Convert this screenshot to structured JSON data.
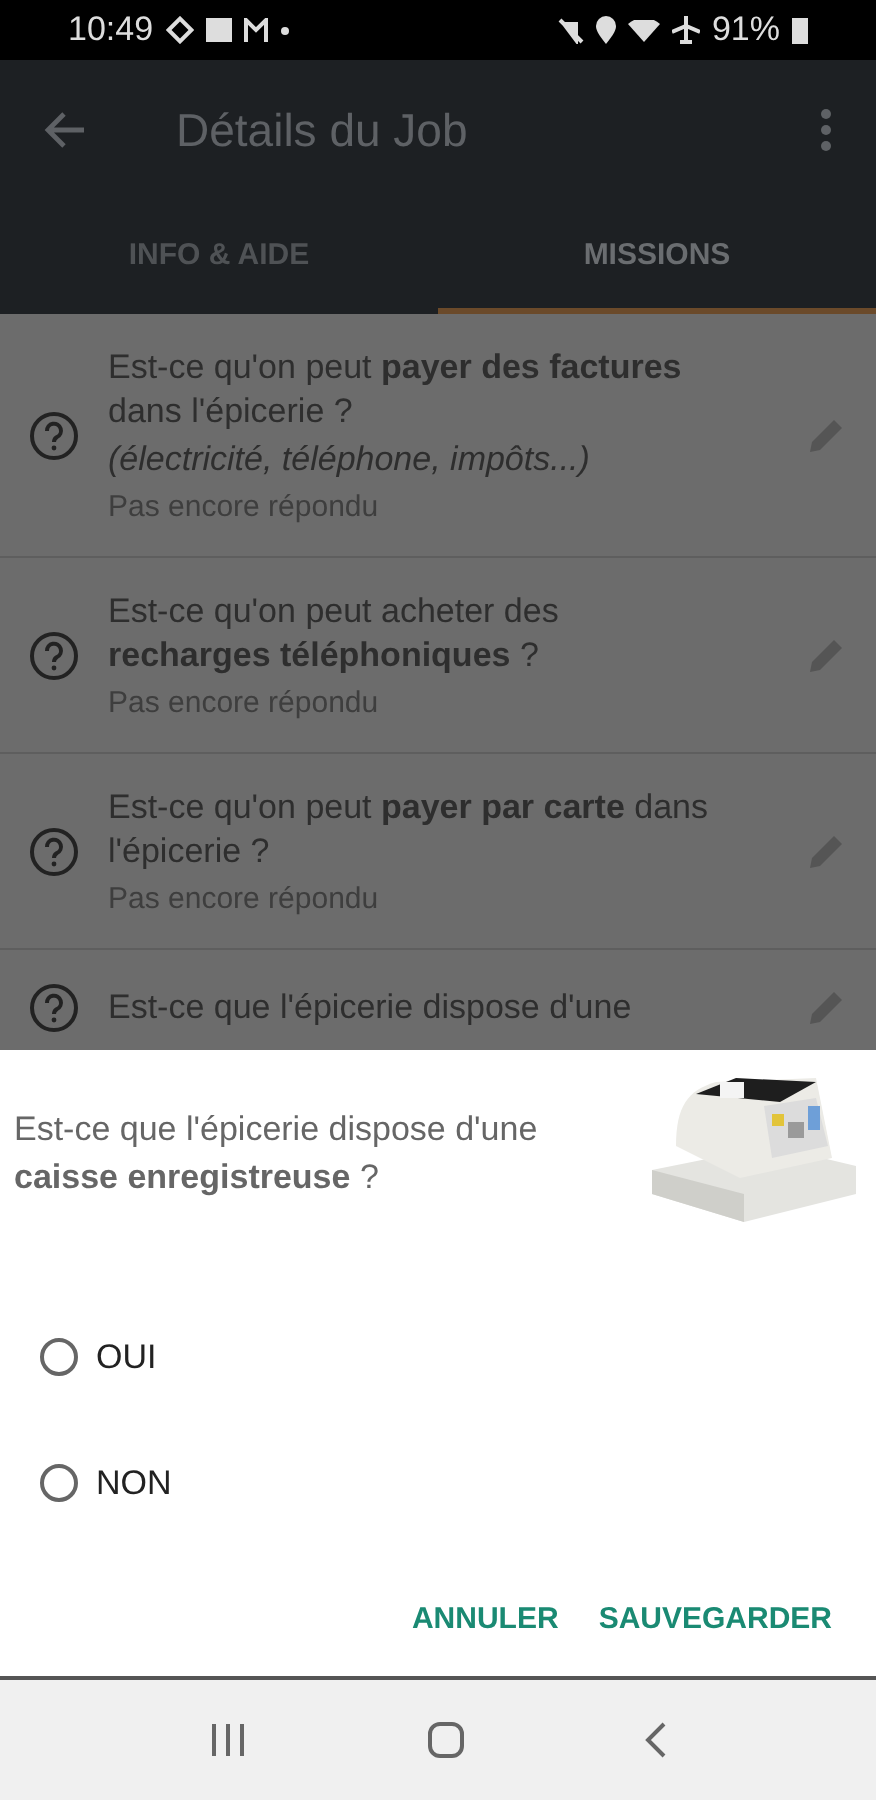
{
  "status_bar": {
    "time": "10:49",
    "battery": "91%"
  },
  "app_bar": {
    "title": "Détails du Job"
  },
  "tabs": [
    {
      "label": "INFO & AIDE",
      "selected": false
    },
    {
      "label": "MISSIONS",
      "selected": true
    }
  ],
  "missions": [
    {
      "question": "Est-ce qu'on peut **payer des factures** dans l'épicerie ?",
      "note": "(électricité, téléphone, impôts...)",
      "status": "Pas encore répondu"
    },
    {
      "question": "Est-ce qu'on peut acheter des **recharges téléphoniques** ?",
      "status": "Pas encore répondu"
    },
    {
      "question": "Est-ce qu'on peut **payer par carte** dans l'épicerie ?",
      "status": "Pas encore répondu"
    },
    {
      "question": "Est-ce que l'épicerie dispose d'une"
    }
  ],
  "dialog": {
    "question": "Est-ce que l'épicerie dispose d'une **caisse enregistreuse** ?",
    "options": [
      {
        "label": "OUI",
        "selected": false
      },
      {
        "label": "NON",
        "selected": false
      }
    ],
    "buttons": [
      "ANNULER",
      "SAUVEGARDER"
    ]
  }
}
